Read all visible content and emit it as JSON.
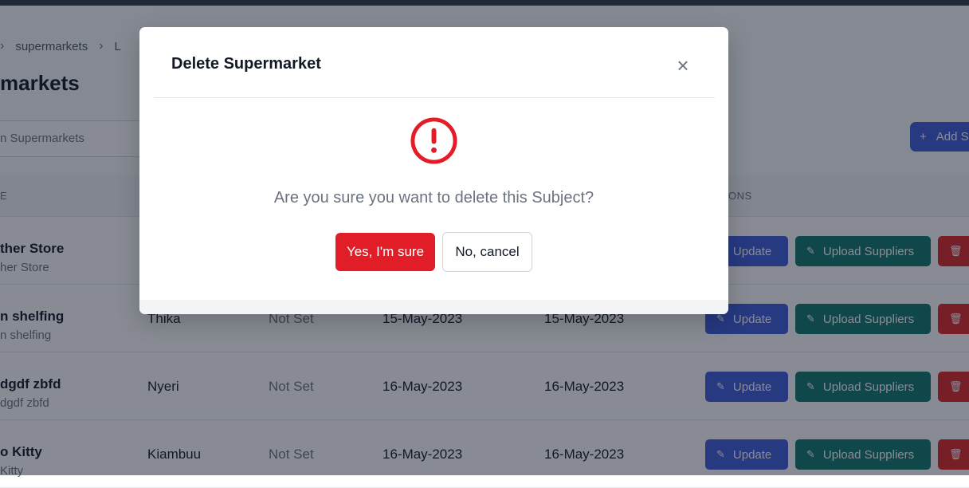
{
  "breadcrumb": {
    "item_1": "supermarkets",
    "item_2": "L"
  },
  "page": {
    "title": "markets"
  },
  "search": {
    "placeholder": "n Supermarkets"
  },
  "toolbar": {
    "add_label": "Add S"
  },
  "table": {
    "headers": {
      "name": "E",
      "actions": "ONS"
    },
    "rows": [
      {
        "name": "ther Store",
        "sub": "her Store",
        "location": "",
        "status": "",
        "created": "",
        "updated": ""
      },
      {
        "name": "n shelfing",
        "sub": "n shelfing",
        "location": "Thika",
        "status": "Not Set",
        "created": "15-May-2023",
        "updated": "15-May-2023"
      },
      {
        "name": "dgdf zbfd",
        "sub": "dgdf zbfd",
        "location": "Nyeri",
        "status": "Not Set",
        "created": "16-May-2023",
        "updated": "16-May-2023"
      },
      {
        "name": "o Kitty",
        "sub": " Kitty",
        "location": "Kiambuu",
        "status": "Not Set",
        "created": "16-May-2023",
        "updated": "16-May-2023"
      }
    ],
    "update_label": "Update",
    "upload_label": "Upload Suppliers"
  },
  "modal": {
    "title": "Delete Supermarket",
    "message": "Are you sure you want to delete this Subject?",
    "confirm_label": "Yes, I'm sure",
    "cancel_label": "No, cancel"
  },
  "colors": {
    "danger": "#e11d27",
    "primary": "#3b5bdb",
    "upload": "#0f766e"
  }
}
